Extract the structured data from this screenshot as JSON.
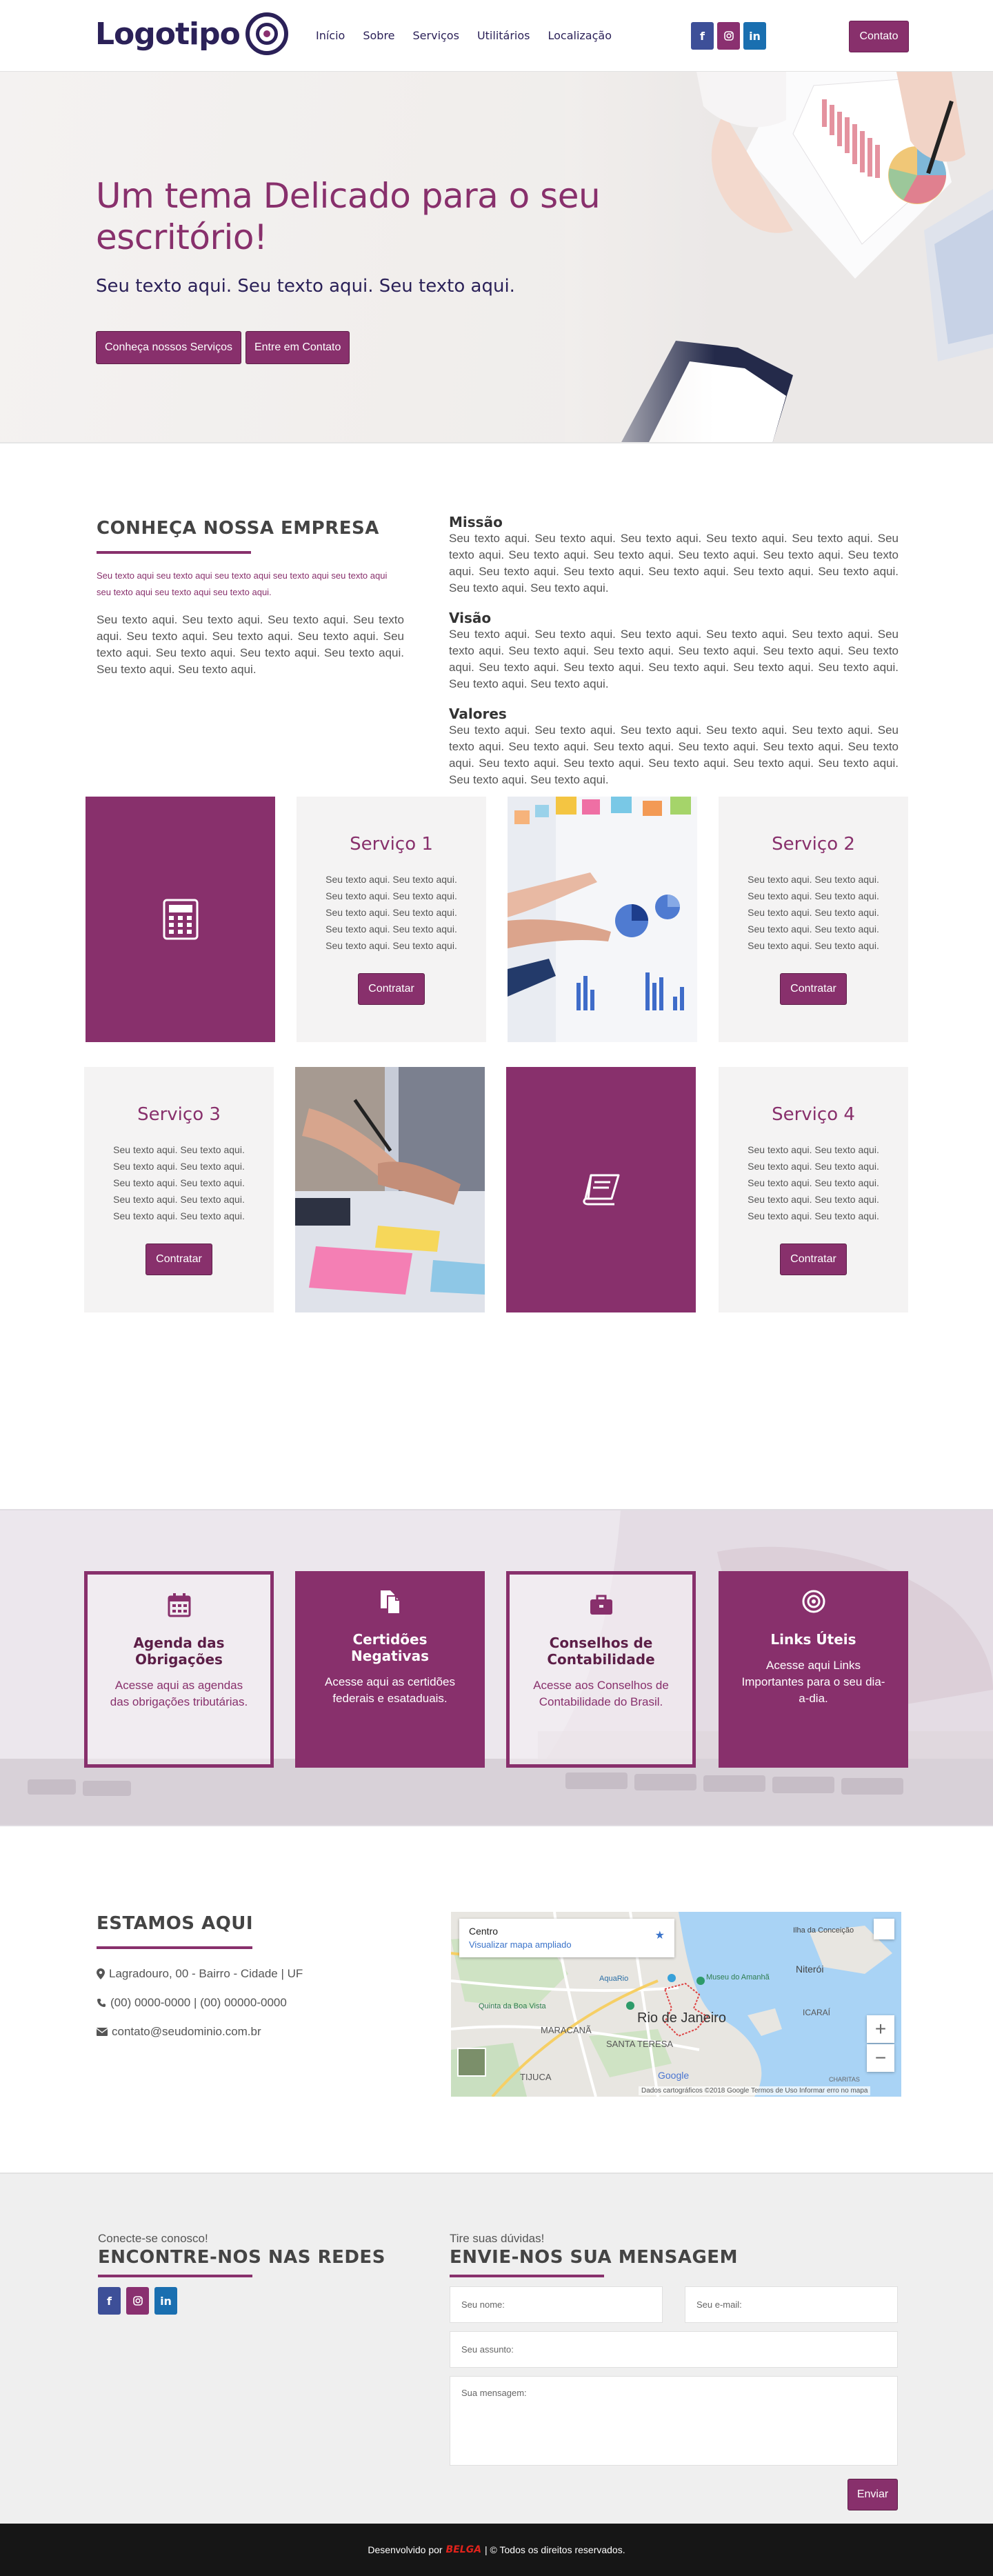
{
  "header": {
    "logo_text": "Logotipo",
    "nav": [
      "Início",
      "Sobre",
      "Serviços",
      "Utilitários",
      "Localização"
    ],
    "social": [
      "f",
      "ig",
      "in"
    ],
    "cta": "Contato"
  },
  "hero": {
    "title": "Um tema Delicado para o seu escritório!",
    "subtitle": "Seu texto aqui. Seu texto aqui. Seu texto aqui.",
    "buttons": [
      "Conheça nossos Serviços",
      "Entre em Contato"
    ]
  },
  "about": {
    "title": "CONHEÇA NOSSA EMPRESA",
    "small": "Seu texto aqui seu texto aqui seu texto aqui seu texto aqui seu texto aqui seu texto aqui seu texto aqui seu texto aqui.",
    "text": "Seu texto aqui. Seu texto aqui. Seu texto aqui. Seu texto aqui. Seu texto aqui. Seu texto aqui. Seu texto aqui. Seu texto aqui. Seu texto aqui. Seu texto aqui. Seu texto aqui. Seu texto aqui. Seu texto aqui.",
    "blocks": [
      {
        "title": "Missão",
        "text": "Seu texto aqui. Seu texto aqui. Seu texto aqui. Seu texto aqui. Seu texto aqui. Seu texto aqui. Seu texto aqui. Seu texto aqui. Seu texto aqui. Seu texto aqui. Seu texto aqui. Seu texto aqui. Seu texto aqui. Seu texto aqui. Seu texto aqui. Seu texto aqui. Seu texto aqui. Seu texto aqui."
      },
      {
        "title": "Visão",
        "text": "Seu texto aqui. Seu texto aqui. Seu texto aqui. Seu texto aqui. Seu texto aqui. Seu texto aqui. Seu texto aqui. Seu texto aqui. Seu texto aqui. Seu texto aqui. Seu texto aqui. Seu texto aqui. Seu texto aqui. Seu texto aqui. Seu texto aqui. Seu texto aqui. Seu texto aqui. Seu texto aqui."
      },
      {
        "title": "Valores",
        "text": "Seu texto aqui. Seu texto aqui. Seu texto aqui. Seu texto aqui. Seu texto aqui. Seu texto aqui. Seu texto aqui. Seu texto aqui. Seu texto aqui. Seu texto aqui. Seu texto aqui. Seu texto aqui. Seu texto aqui. Seu texto aqui. Seu texto aqui. Seu texto aqui. Seu texto aqui. Seu texto aqui."
      }
    ]
  },
  "services": {
    "text": "Seu texto aqui. Seu texto aqui. Seu texto aqui. Seu texto aqui. Seu texto aqui. Seu texto aqui. Seu texto aqui. Seu texto aqui. Seu texto aqui. Seu texto aqui.",
    "button": "Contratar",
    "items": [
      {
        "title": "Serviço 1"
      },
      {
        "title": "Serviço 2"
      },
      {
        "title": "Serviço 3"
      },
      {
        "title": "Serviço 4"
      }
    ],
    "icons": [
      "calculator-icon",
      "book-icon"
    ]
  },
  "utilities": [
    {
      "icon": "calendar-icon",
      "title": "Agenda das Obrigações",
      "text": "Acesse aqui as agendas das obrigações tributárias."
    },
    {
      "icon": "documents-icon",
      "title": "Certidões Negativas",
      "text": "Acesse aqui as certidões federais e esataduais."
    },
    {
      "icon": "briefcase-icon",
      "title": "Conselhos de Contabilidade",
      "text": "Acesse aos Conselhos de Contabilidade do Brasil."
    },
    {
      "icon": "target-icon",
      "title": "Links Úteis",
      "text": "Acesse aqui Links Importantes para o seu dia-a-dia."
    }
  ],
  "location": {
    "title": "ESTAMOS AQUI",
    "address": "Lagradouro, 00 - Bairro - Cidade | UF",
    "phone": "(00) 0000-0000 | (00) 00000-0000",
    "email": "contato@seudominio.com.br",
    "map": {
      "place": "Centro",
      "link": "Visualizar mapa ampliado",
      "city": "Rio de Janeiro",
      "labels": [
        "Niterói",
        "MARACANÃ",
        "SANTA TERESA",
        "TIJUCA",
        "ICARAÍ",
        "Quinta da Boa Vista",
        "Museu do Amanhã",
        "AquaRio",
        "Ilha da Conceição",
        "CHARITAS"
      ],
      "footer": "Dados cartográficos ©2018 Google   Termos de Uso   Informar erro no mapa",
      "google": "Google"
    }
  },
  "contact": {
    "left_pre": "Conecte-se conosco!",
    "left_title": "ENCONTRE-NOS NAS REDES",
    "right_pre": "Tire suas dúvidas!",
    "right_title": "ENVIE-NOS SUA MENSAGEM",
    "name_placeholder": "Seu nome:",
    "email_placeholder": "Seu e-mail:",
    "subject_placeholder": "Seu assunto:",
    "message_placeholder": "Sua mensagem:",
    "submit": "Enviar"
  },
  "footer": {
    "prefix": "Desenvolvido por",
    "brand": "BELGA",
    "suffix": "| © Todos os direitos reservados."
  },
  "colors": {
    "accent": "#88306c",
    "navy": "#2b2158",
    "facebook": "#3d4f98",
    "linkedin": "#1a6fb0"
  }
}
